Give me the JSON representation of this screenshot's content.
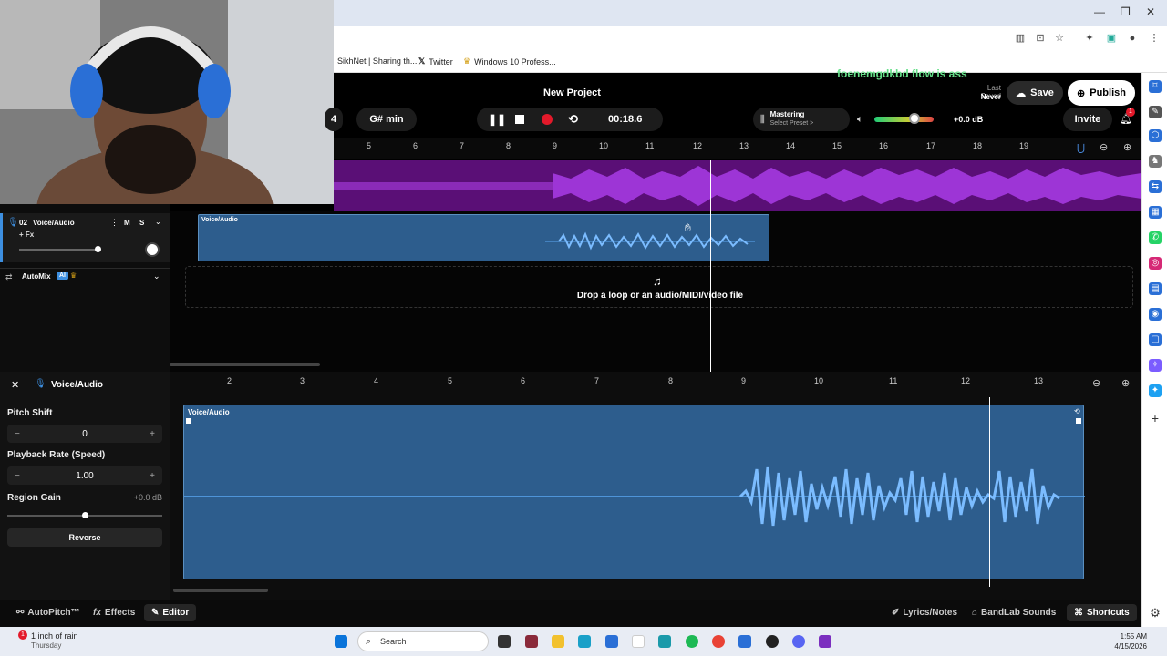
{
  "browser": {
    "bookmarks": [
      "SikhNet | Sharing th...",
      "Twitter",
      "Windows 10 Profess..."
    ]
  },
  "app": {
    "project_title": "New Project",
    "overlay_text": "foenemgdkbd  flow is ass",
    "last_saved_label": "Last Saved",
    "last_saved_value": "Never",
    "save_label": "Save",
    "publish_label": "Publish",
    "invite_label": "Invite",
    "notification_count": "1",
    "key_partial": "4",
    "key": "G# min",
    "time": "00:18.6",
    "mastering_label": "Mastering",
    "mastering_sub": "Select Preset >",
    "volume_db": "+0.0 dB",
    "ruler_top": [
      "5",
      "6",
      "7",
      "8",
      "9",
      "10",
      "11",
      "12",
      "13",
      "14",
      "15",
      "16",
      "17",
      "18",
      "19"
    ],
    "track": {
      "number": "02",
      "name": "Voice/Audio",
      "fx": "+ Fx",
      "mute": "M",
      "solo": "S"
    },
    "automix": "AutoMix",
    "ai_badge": "AI",
    "region_label": "Voice/Audio",
    "drop_text": "Drop a loop or an audio/MIDI/video file"
  },
  "editor": {
    "title": "Voice/Audio",
    "pitch_shift_label": "Pitch Shift",
    "pitch_shift_value": "0",
    "playback_rate_label": "Playback Rate (Speed)",
    "playback_rate_value": "1.00",
    "region_gain_label": "Region Gain",
    "region_gain_value": "+0.0 dB",
    "reverse_label": "Reverse",
    "ruler": [
      "2",
      "3",
      "4",
      "5",
      "6",
      "7",
      "8",
      "9",
      "10",
      "11",
      "12",
      "13"
    ],
    "region_label": "Voice/Audio"
  },
  "bottombar": {
    "autopitch": "AutoPitch™",
    "effects": "Effects",
    "editor": "Editor",
    "lyrics": "Lyrics/Notes",
    "sounds": "BandLab Sounds",
    "shortcuts": "Shortcuts"
  },
  "taskbar": {
    "weather": "1 inch of rain",
    "weather_day": "Thursday",
    "search": "Search",
    "time": "1:55 AM",
    "date": "4/15/2026"
  }
}
